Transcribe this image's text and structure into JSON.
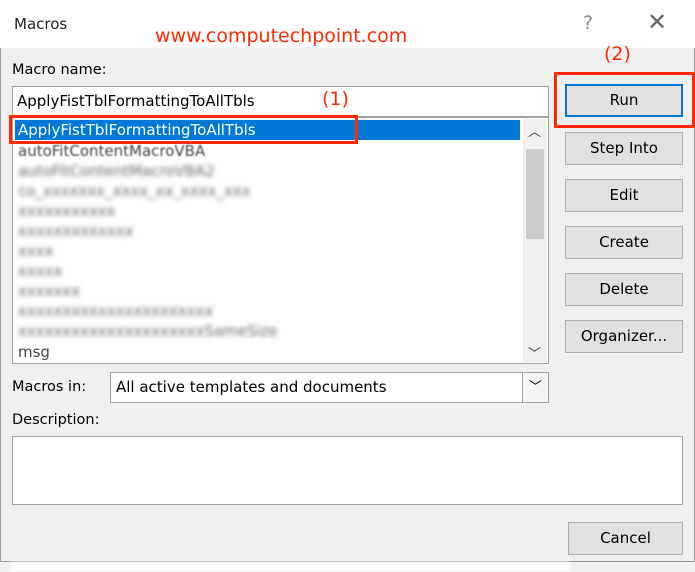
{
  "window": {
    "title": "Macros",
    "help": "?",
    "close": "✕"
  },
  "watermark": "www.computechpoint.com",
  "macro_name": {
    "label": "Macro name:",
    "value": "ApplyFistTblFormattingToAllTbls"
  },
  "macro_list": {
    "items": [
      "ApplyFistTblFormattingToAllTbls",
      "autoFitContentMacroVBA",
      "",
      "",
      "",
      "",
      "",
      "",
      "",
      "",
      "",
      "msg"
    ],
    "selected": 0
  },
  "buttons": {
    "run": "Run",
    "step_into": "Step Into",
    "edit": "Edit",
    "create": "Create",
    "delete": "Delete",
    "organizer": "Organizer...",
    "cancel": "Cancel"
  },
  "macros_in": {
    "label": "Macros in:",
    "value": "All active templates and documents"
  },
  "description": {
    "label": "Description:",
    "value": ""
  },
  "annotations": {
    "one": "(1)",
    "two": "(2)",
    "color": "#ff2a00"
  }
}
